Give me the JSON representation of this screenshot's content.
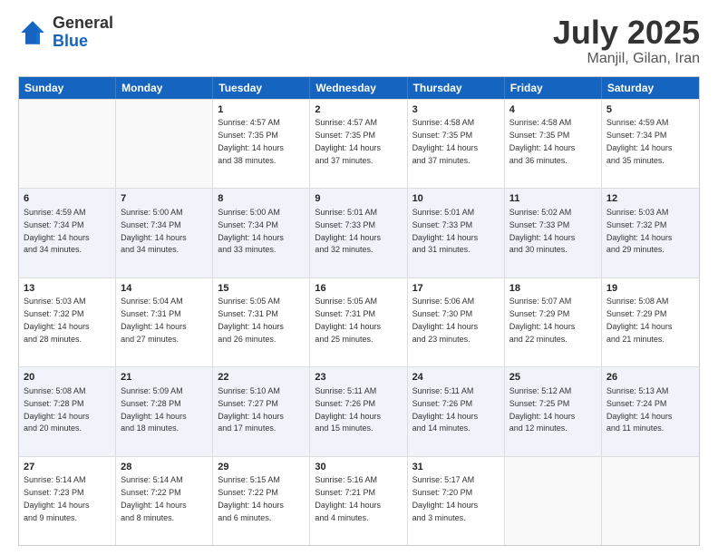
{
  "header": {
    "logo_general": "General",
    "logo_blue": "Blue",
    "title": "July 2025",
    "subtitle": "Manjil, Gilan, Iran"
  },
  "days_of_week": [
    "Sunday",
    "Monday",
    "Tuesday",
    "Wednesday",
    "Thursday",
    "Friday",
    "Saturday"
  ],
  "rows": [
    [
      {
        "day": "",
        "info": ""
      },
      {
        "day": "",
        "info": ""
      },
      {
        "day": "1",
        "info": "Sunrise: 4:57 AM\nSunset: 7:35 PM\nDaylight: 14 hours\nand 38 minutes."
      },
      {
        "day": "2",
        "info": "Sunrise: 4:57 AM\nSunset: 7:35 PM\nDaylight: 14 hours\nand 37 minutes."
      },
      {
        "day": "3",
        "info": "Sunrise: 4:58 AM\nSunset: 7:35 PM\nDaylight: 14 hours\nand 37 minutes."
      },
      {
        "day": "4",
        "info": "Sunrise: 4:58 AM\nSunset: 7:35 PM\nDaylight: 14 hours\nand 36 minutes."
      },
      {
        "day": "5",
        "info": "Sunrise: 4:59 AM\nSunset: 7:34 PM\nDaylight: 14 hours\nand 35 minutes."
      }
    ],
    [
      {
        "day": "6",
        "info": "Sunrise: 4:59 AM\nSunset: 7:34 PM\nDaylight: 14 hours\nand 34 minutes."
      },
      {
        "day": "7",
        "info": "Sunrise: 5:00 AM\nSunset: 7:34 PM\nDaylight: 14 hours\nand 34 minutes."
      },
      {
        "day": "8",
        "info": "Sunrise: 5:00 AM\nSunset: 7:34 PM\nDaylight: 14 hours\nand 33 minutes."
      },
      {
        "day": "9",
        "info": "Sunrise: 5:01 AM\nSunset: 7:33 PM\nDaylight: 14 hours\nand 32 minutes."
      },
      {
        "day": "10",
        "info": "Sunrise: 5:01 AM\nSunset: 7:33 PM\nDaylight: 14 hours\nand 31 minutes."
      },
      {
        "day": "11",
        "info": "Sunrise: 5:02 AM\nSunset: 7:33 PM\nDaylight: 14 hours\nand 30 minutes."
      },
      {
        "day": "12",
        "info": "Sunrise: 5:03 AM\nSunset: 7:32 PM\nDaylight: 14 hours\nand 29 minutes."
      }
    ],
    [
      {
        "day": "13",
        "info": "Sunrise: 5:03 AM\nSunset: 7:32 PM\nDaylight: 14 hours\nand 28 minutes."
      },
      {
        "day": "14",
        "info": "Sunrise: 5:04 AM\nSunset: 7:31 PM\nDaylight: 14 hours\nand 27 minutes."
      },
      {
        "day": "15",
        "info": "Sunrise: 5:05 AM\nSunset: 7:31 PM\nDaylight: 14 hours\nand 26 minutes."
      },
      {
        "day": "16",
        "info": "Sunrise: 5:05 AM\nSunset: 7:31 PM\nDaylight: 14 hours\nand 25 minutes."
      },
      {
        "day": "17",
        "info": "Sunrise: 5:06 AM\nSunset: 7:30 PM\nDaylight: 14 hours\nand 23 minutes."
      },
      {
        "day": "18",
        "info": "Sunrise: 5:07 AM\nSunset: 7:29 PM\nDaylight: 14 hours\nand 22 minutes."
      },
      {
        "day": "19",
        "info": "Sunrise: 5:08 AM\nSunset: 7:29 PM\nDaylight: 14 hours\nand 21 minutes."
      }
    ],
    [
      {
        "day": "20",
        "info": "Sunrise: 5:08 AM\nSunset: 7:28 PM\nDaylight: 14 hours\nand 20 minutes."
      },
      {
        "day": "21",
        "info": "Sunrise: 5:09 AM\nSunset: 7:28 PM\nDaylight: 14 hours\nand 18 minutes."
      },
      {
        "day": "22",
        "info": "Sunrise: 5:10 AM\nSunset: 7:27 PM\nDaylight: 14 hours\nand 17 minutes."
      },
      {
        "day": "23",
        "info": "Sunrise: 5:11 AM\nSunset: 7:26 PM\nDaylight: 14 hours\nand 15 minutes."
      },
      {
        "day": "24",
        "info": "Sunrise: 5:11 AM\nSunset: 7:26 PM\nDaylight: 14 hours\nand 14 minutes."
      },
      {
        "day": "25",
        "info": "Sunrise: 5:12 AM\nSunset: 7:25 PM\nDaylight: 14 hours\nand 12 minutes."
      },
      {
        "day": "26",
        "info": "Sunrise: 5:13 AM\nSunset: 7:24 PM\nDaylight: 14 hours\nand 11 minutes."
      }
    ],
    [
      {
        "day": "27",
        "info": "Sunrise: 5:14 AM\nSunset: 7:23 PM\nDaylight: 14 hours\nand 9 minutes."
      },
      {
        "day": "28",
        "info": "Sunrise: 5:14 AM\nSunset: 7:22 PM\nDaylight: 14 hours\nand 8 minutes."
      },
      {
        "day": "29",
        "info": "Sunrise: 5:15 AM\nSunset: 7:22 PM\nDaylight: 14 hours\nand 6 minutes."
      },
      {
        "day": "30",
        "info": "Sunrise: 5:16 AM\nSunset: 7:21 PM\nDaylight: 14 hours\nand 4 minutes."
      },
      {
        "day": "31",
        "info": "Sunrise: 5:17 AM\nSunset: 7:20 PM\nDaylight: 14 hours\nand 3 minutes."
      },
      {
        "day": "",
        "info": ""
      },
      {
        "day": "",
        "info": ""
      }
    ]
  ]
}
